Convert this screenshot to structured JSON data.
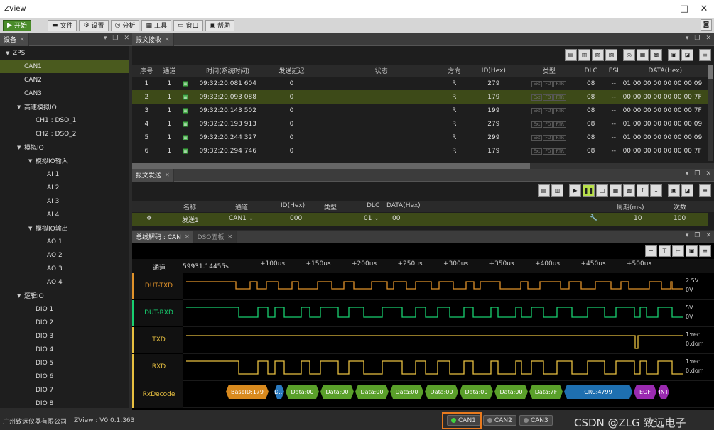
{
  "app": {
    "title": "ZView"
  },
  "menu": [
    {
      "label": "开始",
      "icon": "play-icon"
    },
    {
      "label": "文件",
      "icon": "folder-icon"
    },
    {
      "label": "设置",
      "icon": "gear-icon"
    },
    {
      "label": "分析",
      "icon": "analyze-icon"
    },
    {
      "label": "工具",
      "icon": "tools-icon"
    },
    {
      "label": "窗口",
      "icon": "window-icon"
    },
    {
      "label": "帮助",
      "icon": "help-icon"
    }
  ],
  "device_panel": {
    "tab": "设备",
    "tree": [
      {
        "label": "ZPS",
        "lvl": 0,
        "arrow": "▼"
      },
      {
        "label": "CAN1",
        "lvl": 1,
        "sel": true
      },
      {
        "label": "CAN2",
        "lvl": 1
      },
      {
        "label": "CAN3",
        "lvl": 1
      },
      {
        "label": "高速模拟IO",
        "lvl": 1,
        "arrow": "▼"
      },
      {
        "label": "CH1 : DSO_1",
        "lvl": 2
      },
      {
        "label": "CH2 : DSO_2",
        "lvl": 2
      },
      {
        "label": "模拟IO",
        "lvl": 1,
        "arrow": "▼"
      },
      {
        "label": "模拟IO输入",
        "lvl": 2,
        "arrow": "▼"
      },
      {
        "label": "AI 1",
        "lvl": 3
      },
      {
        "label": "AI 2",
        "lvl": 3
      },
      {
        "label": "AI 3",
        "lvl": 3
      },
      {
        "label": "AI 4",
        "lvl": 3
      },
      {
        "label": "模拟IO输出",
        "lvl": 2,
        "arrow": "▼"
      },
      {
        "label": "AO 1",
        "lvl": 3
      },
      {
        "label": "AO 2",
        "lvl": 3
      },
      {
        "label": "AO 3",
        "lvl": 3
      },
      {
        "label": "AO 4",
        "lvl": 3
      },
      {
        "label": "逻辑IO",
        "lvl": 1,
        "arrow": "▼"
      },
      {
        "label": "DIO 1",
        "lvl": 2
      },
      {
        "label": "DIO 2",
        "lvl": 2
      },
      {
        "label": "DIO 3",
        "lvl": 2
      },
      {
        "label": "DIO 4",
        "lvl": 2
      },
      {
        "label": "DIO 5",
        "lvl": 2
      },
      {
        "label": "DIO 6",
        "lvl": 2
      },
      {
        "label": "DIO 7",
        "lvl": 2
      },
      {
        "label": "DIO 8",
        "lvl": 2
      }
    ]
  },
  "recv_panel": {
    "tab": "报文接收",
    "columns": [
      "序号",
      "通道",
      "",
      "时间(系统时间)",
      "发送延迟",
      "状态",
      "方向",
      "ID(Hex)",
      "类型",
      "DLC",
      "ESI",
      "DATA(Hex)"
    ],
    "flags": [
      "Ext",
      "FD",
      "RTR"
    ],
    "rows": [
      [
        "1",
        "1",
        "09:32:20.081 604",
        "0",
        "",
        "R",
        "279",
        "08",
        "--",
        "01 00 00 00 00 00 00 09"
      ],
      [
        "2",
        "1",
        "09:32:20.093 088",
        "0",
        "",
        "R",
        "179",
        "08",
        "--",
        "00 00 00 00 00 00 00 7F"
      ],
      [
        "3",
        "1",
        "09:32:20.143 502",
        "0",
        "",
        "R",
        "199",
        "08",
        "--",
        "00 00 00 00 00 00 00 7F"
      ],
      [
        "4",
        "1",
        "09:32:20.193 913",
        "0",
        "",
        "R",
        "279",
        "08",
        "--",
        "01 00 00 00 00 00 00 09"
      ],
      [
        "5",
        "1",
        "09:32:20.244 327",
        "0",
        "",
        "R",
        "299",
        "08",
        "--",
        "01 00 00 00 00 00 00 09"
      ],
      [
        "6",
        "1",
        "09:32:20.294 746",
        "0",
        "",
        "R",
        "179",
        "08",
        "--",
        "00 00 00 00 00 00 00 7F"
      ]
    ]
  },
  "send_panel": {
    "tab": "报文发送",
    "columns": [
      "名称",
      "通道",
      "ID(Hex)",
      "类型",
      "DLC",
      "DATA(Hex)",
      "周期(ms)",
      "次数"
    ],
    "row": {
      "name": "发送1",
      "channel": "CAN1",
      "id": "000",
      "dlc": "01",
      "data": "00",
      "period": "10",
      "count": "100"
    }
  },
  "decode_panel": {
    "tabs": [
      "总线解码 : CAN",
      "DSO面板"
    ],
    "channel_label": "通道",
    "time_origin": "59931.14455s",
    "ticks": [
      "+100us",
      "+150us",
      "+200us",
      "+250us",
      "+300us",
      "+350us",
      "+400us",
      "+450us",
      "+500us"
    ],
    "signals": [
      {
        "name": "DUT-TXD",
        "color": "#e0922a",
        "scale_hi": "2.5V",
        "scale_lo": "0V"
      },
      {
        "name": "DUT-RXD",
        "color": "#18d070",
        "scale_hi": "5V",
        "scale_lo": "0V"
      },
      {
        "name": "TXD",
        "color": "#e8c040",
        "scale_hi": "1:rec",
        "scale_lo": "0:dom"
      },
      {
        "name": "RXD",
        "color": "#e8c040",
        "scale_hi": "1:rec",
        "scale_lo": "0:dom"
      },
      {
        "name": "RxDecode",
        "color": "#e8c040"
      }
    ],
    "segments": [
      {
        "label": "BaseID:179",
        "color": "#d98a1e"
      },
      {
        "label": "D...",
        "color": "#2a7ac0"
      },
      {
        "label": "Data:00",
        "color": "#5aa02a"
      },
      {
        "label": "Data:00",
        "color": "#5aa02a"
      },
      {
        "label": "Data:00",
        "color": "#5aa02a"
      },
      {
        "label": "Data:00",
        "color": "#5aa02a"
      },
      {
        "label": "Data:00",
        "color": "#5aa02a"
      },
      {
        "label": "Data:00",
        "color": "#5aa02a"
      },
      {
        "label": "Data:00",
        "color": "#5aa02a"
      },
      {
        "label": "Data:7F",
        "color": "#5aa02a"
      },
      {
        "label": "CRC:4799",
        "color": "#1e6fb0"
      },
      {
        "label": "EOF",
        "color": "#9a2ab0"
      },
      {
        "label": "INT",
        "color": "#9a2ab0"
      }
    ]
  },
  "status": {
    "company": "广州致远仪器有限公司",
    "version": "ZView : V0.0.1.363",
    "channels": [
      {
        "label": "CAN1",
        "on": true
      },
      {
        "label": "CAN2",
        "on": false
      },
      {
        "label": "CAN3",
        "on": false
      }
    ],
    "watermark": "CSDN @ZLG 致远电子"
  }
}
